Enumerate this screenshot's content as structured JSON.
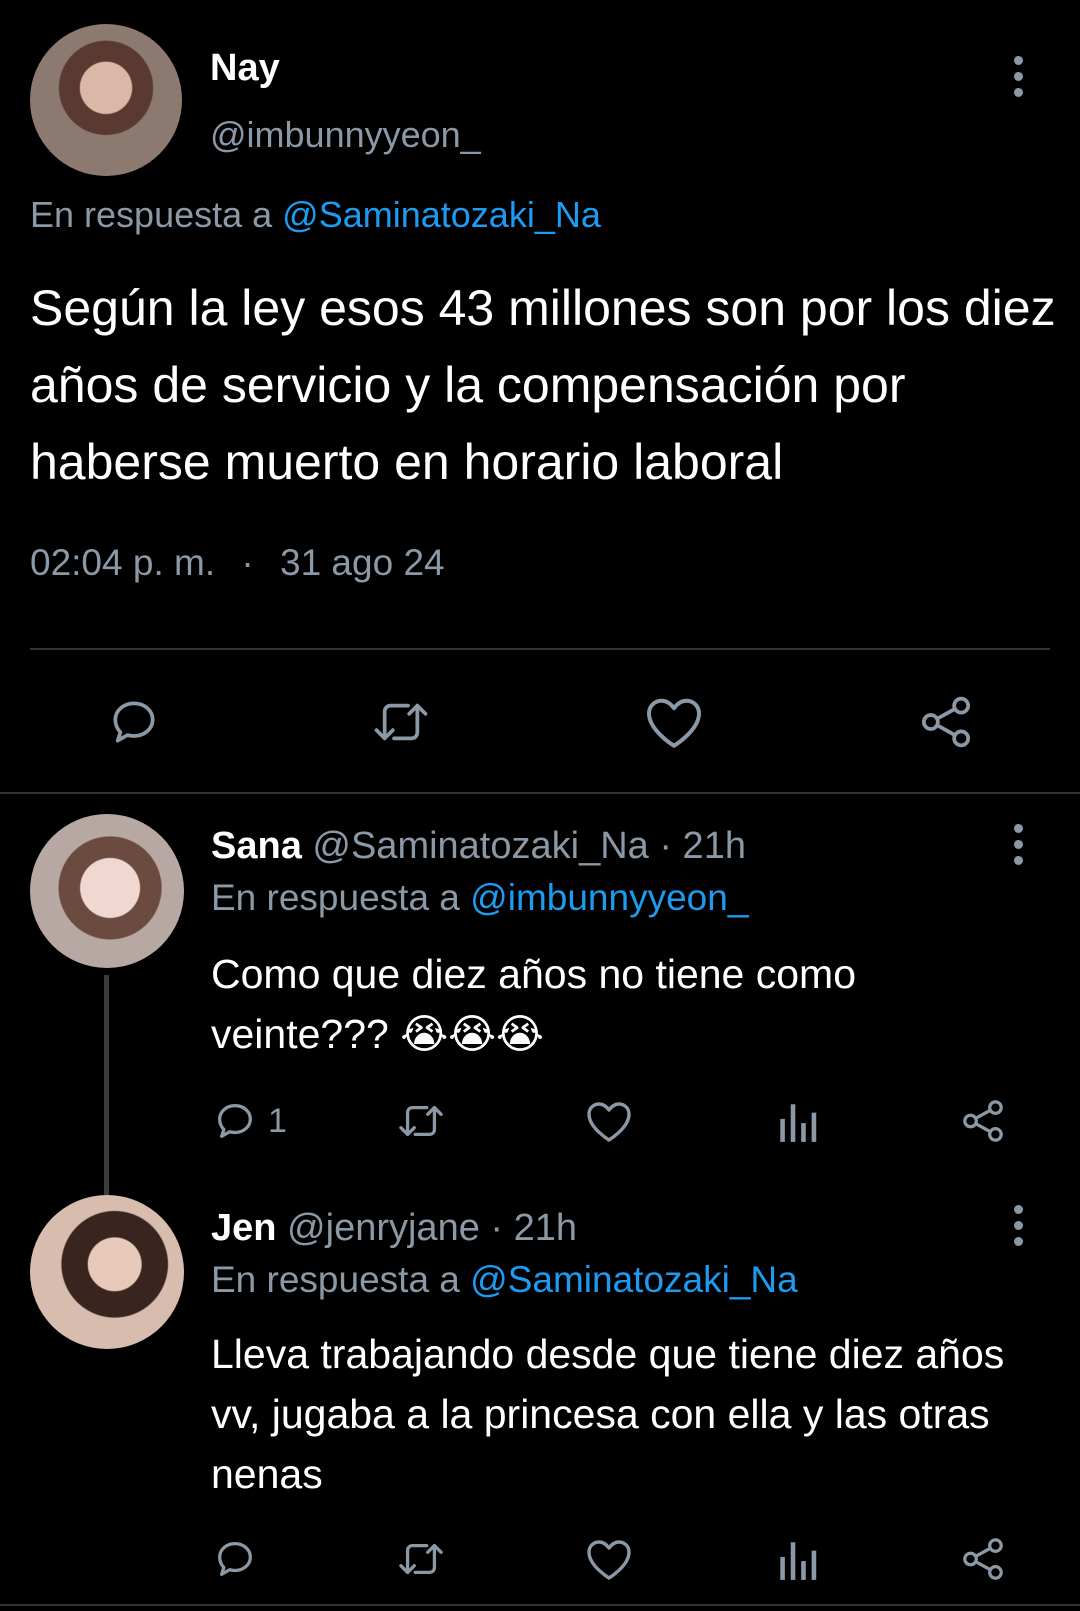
{
  "main_tweet": {
    "display_name": "Nay",
    "handle": "@imbunnyyeon_",
    "reply_prefix": "En respuesta a",
    "reply_to": "@Saminatozaki_Na",
    "text": "Según la ley esos 43 millones son por los diez años de servicio y la compensación por haberse muerto en horario laboral",
    "time": "02:04 p. m.",
    "separator": "·",
    "date": "31 ago 24",
    "actions": [
      "reply-icon",
      "retweet-icon",
      "like-icon",
      "share-icon"
    ]
  },
  "replies": [
    {
      "display_name": "Sana",
      "handle_time": "@Saminatozaki_Na · 21h",
      "reply_prefix": "En respuesta a",
      "reply_to": "@imbunnyyeon_",
      "text_line1": "Como que diez años no tiene como",
      "text_line2": "veinte??? 😭😭😭",
      "reply_count": "1"
    },
    {
      "display_name": "Jen",
      "handle_time": "@jenryjane · 21h",
      "reply_prefix": "En respuesta a",
      "reply_to": "@Saminatozaki_Na",
      "text": "Lleva trabajando desde que tiene diez años vv, jugaba a la princesa con ella y las otras nenas"
    }
  ],
  "colors": {
    "background": "#000000",
    "text": "#ffffff",
    "muted": "#8b98a5",
    "link": "#1d9bf0",
    "divider": "#2f3336"
  }
}
